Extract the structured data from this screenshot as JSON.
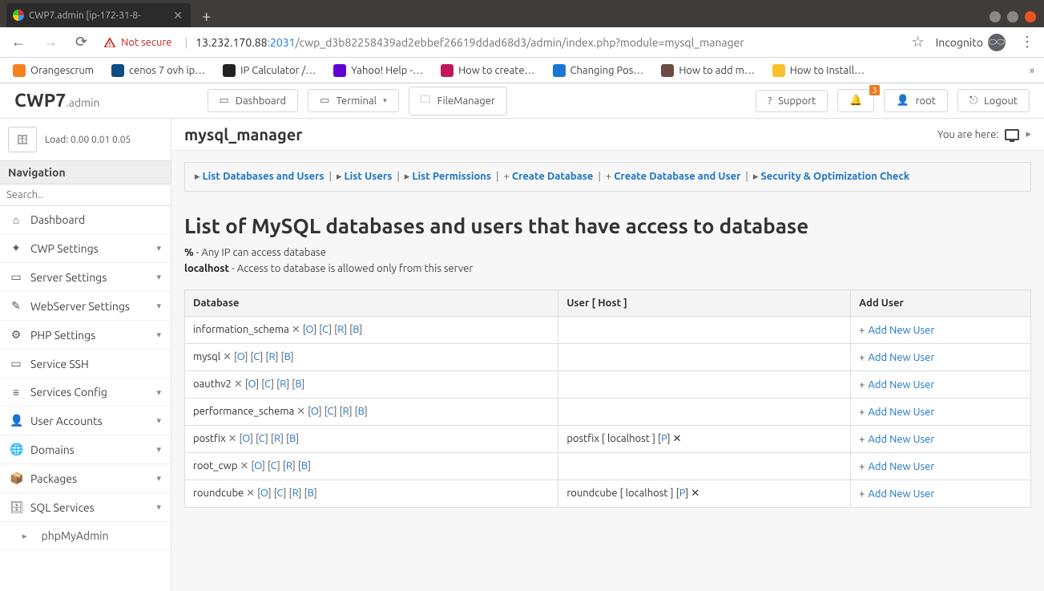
{
  "browser": {
    "tab_title": "CWP7.admin [ip-172-31-8-",
    "new_tab": "+",
    "not_secure": "Not secure",
    "url_host": "13.232.170.88",
    "url_port": ":2031",
    "url_path": "/cwp_d3b82258439ad2ebbef26619ddad68d3/admin/index.php?module=mysql_manager",
    "incognito": "Incognito",
    "menu_dots": "⋮",
    "star": "☆"
  },
  "bookmarks": [
    {
      "label": "Orangescrum",
      "color": "#f58220"
    },
    {
      "label": "cenos 7 ovh ip…",
      "color": "#0f4c81"
    },
    {
      "label": "IP Calculator /…",
      "color": "#222"
    },
    {
      "label": "Yahoo! Help -…",
      "color": "#5f01d1"
    },
    {
      "label": "How to create…",
      "color": "#c2185b"
    },
    {
      "label": "Changing Pos…",
      "color": "#1976d2"
    },
    {
      "label": "How to add m…",
      "color": "#6d4c41"
    },
    {
      "label": "How to Install…",
      "color": "#fbc02d"
    }
  ],
  "header": {
    "brand_main": "CWP7",
    "brand_sub": ".admin",
    "dashboard": "Dashboard",
    "terminal": "Terminal",
    "filemanager": "FileManager",
    "support": "Support",
    "notif_count": "3",
    "root": "root",
    "logout": "Logout"
  },
  "sidebar": {
    "load_label": "Load: 0.00  0.01  0.05",
    "nav_header": "Navigation",
    "search_placeholder": "Search..",
    "items": [
      {
        "icon": "⌂",
        "label": "Dashboard",
        "exp": false
      },
      {
        "icon": "✦",
        "label": "CWP Settings",
        "exp": true
      },
      {
        "icon": "▭",
        "label": "Server Settings",
        "exp": true
      },
      {
        "icon": "✎",
        "label": "WebServer Settings",
        "exp": true
      },
      {
        "icon": "⚙",
        "label": "PHP Settings",
        "exp": true
      },
      {
        "icon": "▭",
        "label": "Service SSH",
        "exp": false
      },
      {
        "icon": "≡",
        "label": "Services Config",
        "exp": true
      },
      {
        "icon": "👤",
        "label": "User Accounts",
        "exp": true
      },
      {
        "icon": "🌐",
        "label": "Domains",
        "exp": true
      },
      {
        "icon": "📦",
        "label": "Packages",
        "exp": true
      },
      {
        "icon": "🗄",
        "label": "SQL Services",
        "exp": true
      }
    ],
    "subitem": "phpMyAdmin"
  },
  "page": {
    "module": "mysql_manager",
    "you_are_here": "You are here:",
    "actions": [
      {
        "pre": "▸",
        "label": "List Databases and Users"
      },
      {
        "pre": "▸",
        "label": "List Users"
      },
      {
        "pre": "▸",
        "label": "List Permissions"
      },
      {
        "pre": "+",
        "label": "Create Database"
      },
      {
        "pre": "+",
        "label": "Create Database and User"
      },
      {
        "pre": "▸",
        "label": "Security & Optimization Check"
      }
    ],
    "title": "List of MySQL databases and users that have access to database",
    "hint1_key": "%",
    "hint1_txt": " - Any IP can access database",
    "hint2_key": "localhost",
    "hint2_txt": " - Access to database is allowed only from this server",
    "cols": {
      "db": "Database",
      "user": "User [ Host ]",
      "add": "Add User"
    },
    "ops": [
      "O",
      "C",
      "R",
      "B"
    ],
    "add_new_user": "Add New User",
    "rows": [
      {
        "db": "information_schema",
        "user": ""
      },
      {
        "db": "mysql",
        "user": ""
      },
      {
        "db": "oauthv2",
        "user": ""
      },
      {
        "db": "performance_schema",
        "user": ""
      },
      {
        "db": "postfix",
        "user": "postfix [ localhost ] [",
        "user_p": "P",
        "user_tail": "] ✕"
      },
      {
        "db": "root_cwp",
        "user": ""
      },
      {
        "db": "roundcube",
        "user": "roundcube [ localhost ] [",
        "user_p": "P",
        "user_tail": "] ✕"
      }
    ]
  }
}
